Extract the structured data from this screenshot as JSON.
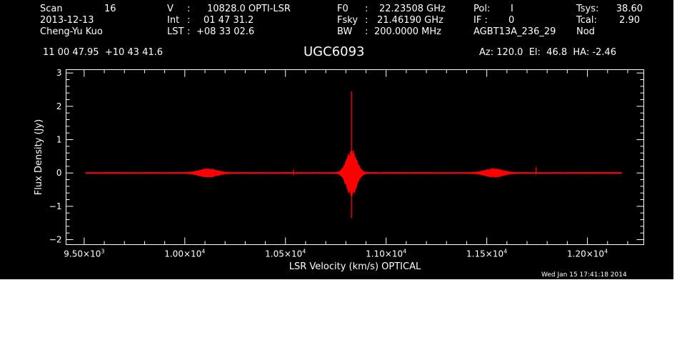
{
  "header": {
    "scan_label": "Scan",
    "scan_value": "16",
    "date": "2013-12-13",
    "observer": "Cheng-Yu Kuo",
    "v_label": "V",
    "v_value": "10828.0 OPTI-LSR",
    "int_label": "Int",
    "int_value": "01 47 31.2",
    "lst_label": "LST",
    "lst_value": "+08 33 02.6",
    "f0_label": "F0",
    "f0_value": "22.23508 GHz",
    "fsky_label": "Fsky",
    "fsky_value": "21.46190 GHz",
    "bw_label": "BW",
    "bw_value": "200.0000 MHz",
    "pol_label": "Pol:",
    "pol_value": "I",
    "if_label": "IF :",
    "if_value": "0",
    "project": "AGBT13A_236_29",
    "tsys_label": "Tsys:",
    "tsys_value": "38.60",
    "tcal_label": "Tcal:",
    "tcal_value": "2.90",
    "mode": "Nod",
    "coords": "11 00 47.95  +10 43 41.6",
    "source": "UGC6093",
    "pointing": "Az: 120.0  El:  46.8  HA: -2.46"
  },
  "footer": {
    "timestamp": "Wed Jan 15 17:41:18 2014"
  },
  "chart_data": {
    "type": "line",
    "title": "UGC6093",
    "xlabel": "LSR Velocity (km/s) OPTICAL",
    "ylabel": "Flux Density (Jy)",
    "xlim": [
      9410,
      12280
    ],
    "ylim": [
      -2.15,
      3.1
    ],
    "x_ticks": [
      {
        "value": 9500,
        "mant": "9.50×10",
        "exp": "3"
      },
      {
        "value": 10000,
        "mant": "1.00×10",
        "exp": "4"
      },
      {
        "value": 10500,
        "mant": "1.05×10",
        "exp": "4"
      },
      {
        "value": 11000,
        "mant": "1.10×10",
        "exp": "4"
      },
      {
        "value": 11500,
        "mant": "1.15×10",
        "exp": "4"
      },
      {
        "value": 12000,
        "mant": "1.20×10",
        "exp": "4"
      }
    ],
    "y_ticks": [
      {
        "value": -2,
        "label": "−2"
      },
      {
        "value": -1,
        "label": "−1"
      },
      {
        "value": 0,
        "label": "0"
      },
      {
        "value": 1,
        "label": "1"
      },
      {
        "value": 2,
        "label": "2"
      },
      {
        "value": 3,
        "label": "3"
      }
    ],
    "series": [
      {
        "color": "#ff0000",
        "x_range": [
          9508,
          12170
        ],
        "features": [
          {
            "type": "spike",
            "x": 10828,
            "ymax": 2.45,
            "ymin": -1.35
          },
          {
            "type": "bump",
            "x": 10828,
            "amp": 0.7,
            "width": 35
          },
          {
            "type": "bump",
            "x": 10115,
            "amp": 0.12,
            "width": 60
          },
          {
            "type": "bump",
            "x": 11535,
            "amp": 0.12,
            "width": 60
          },
          {
            "type": "spike",
            "x": 10540,
            "ymax": 0.1,
            "ymin": -0.06
          },
          {
            "type": "spike",
            "x": 11745,
            "ymax": 0.18,
            "ymin": -0.05
          }
        ]
      }
    ]
  }
}
